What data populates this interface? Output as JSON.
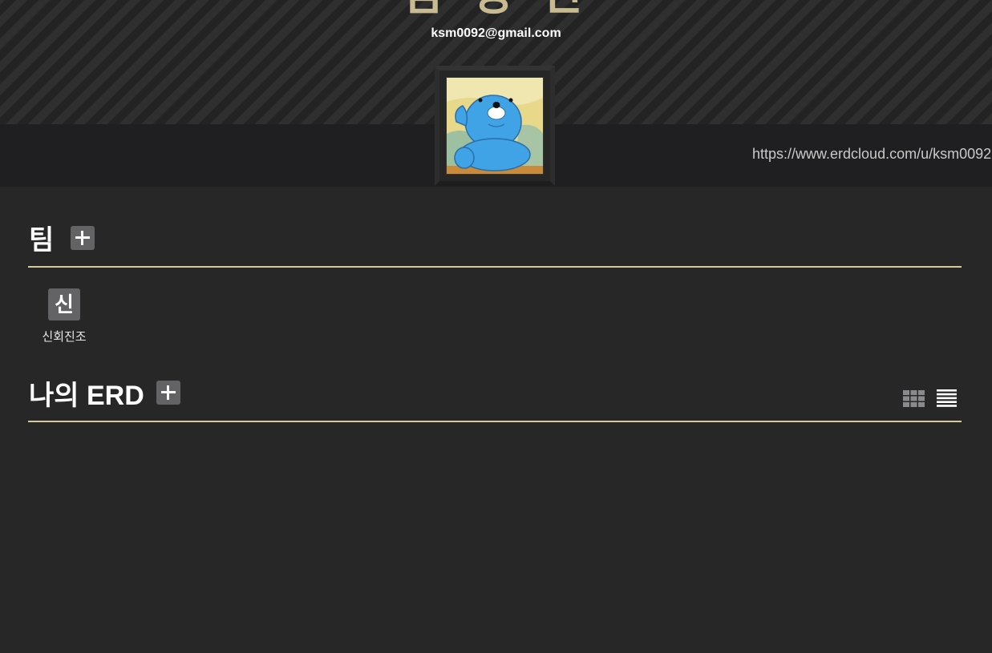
{
  "profile": {
    "name": "김 성 민",
    "email": "ksm0092@gmail.com",
    "url": "https://www.erdcloud.com/u/ksm0092"
  },
  "teams_section": {
    "title": "팀",
    "teams": [
      {
        "initial": "신",
        "name": "신회진조"
      }
    ]
  },
  "erd_section": {
    "title": "나의 ERD"
  },
  "icons": {
    "add": "plus-icon",
    "grid_view": "grid-view-icon",
    "list_view": "list-view-icon",
    "avatar": "avatar-image"
  },
  "colors": {
    "background": "#272727",
    "accent_gold": "#d8c89a",
    "button_gray": "#636365"
  }
}
